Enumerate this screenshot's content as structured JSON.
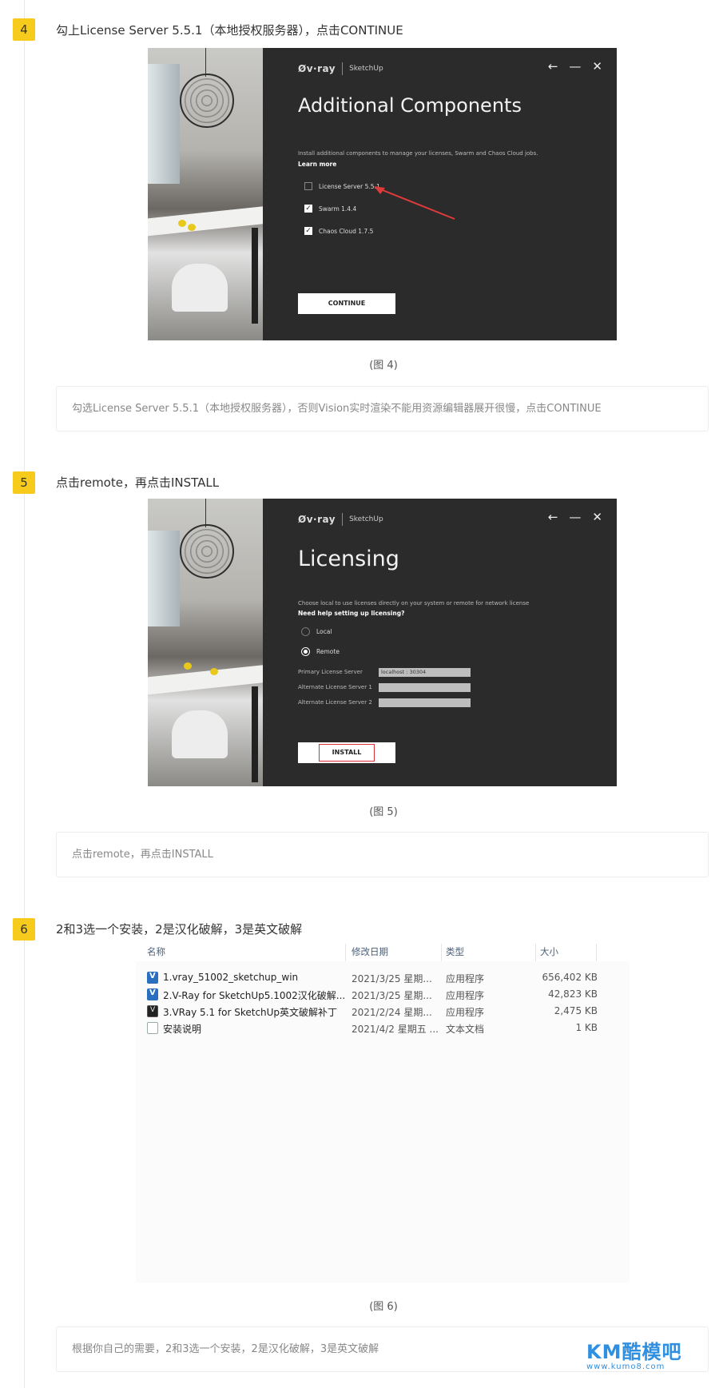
{
  "steps": {
    "s4": {
      "num": "4",
      "title": "勾上License Server 5.5.1（本地授权服务器），点击CONTINUE",
      "caption": "(图 4)",
      "note": "勾选License Server 5.5.1（本地授权服务器），否则Vision实时渲染不能用资源编辑器展开很慢，点击CONTINUE"
    },
    "s5": {
      "num": "5",
      "title": "点击remote，再点击INSTALL",
      "caption": "(图 5)",
      "note": "点击remote，再点击INSTALL"
    },
    "s6": {
      "num": "6",
      "title": "2和3选一个安装，2是汉化破解，3是英文破解",
      "caption": "(图 6)",
      "note": "根据你自己的需要，2和3选一个安装，2是汉化破解，3是英文破解"
    }
  },
  "installer": {
    "brand_vray": "Øv·ray",
    "brand_app": "SketchUp",
    "back_icon": "←",
    "min_icon": "—",
    "close_icon": "✕",
    "components": {
      "heading": "Additional Components",
      "desc": "Install additional components to manage your licenses, Swarm and Chaos Cloud jobs.",
      "learn_more": "Learn more",
      "options": [
        {
          "label": "License Server 5.5.1",
          "checked": false
        },
        {
          "label": "Swarm 1.4.4",
          "checked": true
        },
        {
          "label": "Chaos Cloud 1.7.5",
          "checked": true
        }
      ],
      "continue_label": "CONTINUE",
      "arrow_color": "#e03b3b"
    },
    "licensing": {
      "heading": "Licensing",
      "desc": "Choose local to use licenses directly on your system or remote for network license",
      "help": "Need help setting up licensing?",
      "local_label": "Local",
      "remote_label": "Remote",
      "primary_label": "Primary License Server",
      "primary_value": "localhost : 30304",
      "alt1_label": "Alternate License Server 1",
      "alt2_label": "Alternate License Server 2",
      "install_label": "INSTALL",
      "highlight_color": "#d9303a"
    }
  },
  "explorer": {
    "columns": {
      "name": "名称",
      "date": "修改日期",
      "type": "类型",
      "size": "大小"
    },
    "files": [
      {
        "name": "1.vray_51002_sketchup_win",
        "date": "2021/3/25 星期...",
        "type": "应用程序",
        "size": "656,402 KB",
        "icon": "vray-installer-icon"
      },
      {
        "name": "2.V-Ray for SketchUp5.1002汉化破解...",
        "date": "2021/3/25 星期...",
        "type": "应用程序",
        "size": "42,823 KB",
        "icon": "vray-installer-icon"
      },
      {
        "name": "3.VRay 5.1 for SketchUp英文破解补丁",
        "date": "2021/2/24 星期...",
        "type": "应用程序",
        "size": "2,475 KB",
        "icon": "patch-icon"
      },
      {
        "name": "安装说明",
        "date": "2021/4/2 星期五 ...",
        "type": "文本文档",
        "size": "1 KB",
        "icon": "text-file-icon"
      }
    ]
  },
  "watermark": {
    "main": "KM酷模吧",
    "sub": "www.kumo8.com"
  },
  "colors": {
    "badge": "#f7cb1c",
    "brand_blue": "#2f8fe0"
  }
}
